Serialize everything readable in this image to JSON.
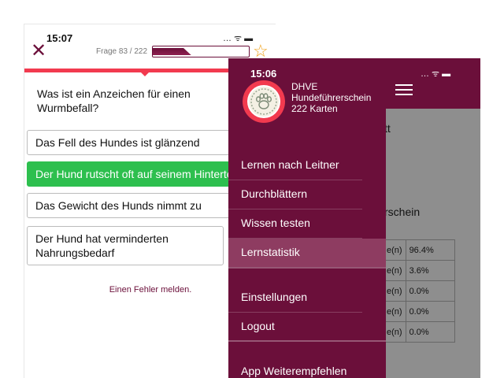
{
  "quiz": {
    "time": "15:07",
    "status_icons": "… ᯤ ▬",
    "close_icon": "✕",
    "counter": "Frage 83 / 222",
    "progress": 0.37,
    "star_icon": "☆",
    "question": "Was ist ein Anzeichen für einen Wurmbefall?",
    "answers": [
      "Das Fell des Hundes ist glänzend",
      "Der Hund rutscht oft auf seinem Hinterteil",
      "Das Gewicht des Hunds nimmt zu",
      "Der Hund hat verminderten Nahrungsbedarf"
    ],
    "report": "Einen Fehler melden."
  },
  "drawer": {
    "time": "15:06",
    "brand_line1": "DHVE",
    "brand_line2": "Hundeführerschein",
    "brand_line3": "222 Karten",
    "items": [
      "Lernen nach Leitner",
      "Durchblättern",
      "Wissen testen",
      "Lernstatistik",
      "Einstellungen",
      "Logout",
      "App Weiterempfehlen"
    ]
  },
  "stats_page": {
    "status_icons": "… ᯤ ▬",
    "frag1": "tt",
    "frag2": "rschein",
    "rows": [
      {
        "label": "e(n)",
        "value": "96.4%"
      },
      {
        "label": "e(n)",
        "value": "3.6%"
      },
      {
        "label": "e(n)",
        "value": "0.0%"
      },
      {
        "label": "e(n)",
        "value": "0.0%"
      },
      {
        "label": "e(n)",
        "value": "0.0%"
      }
    ]
  },
  "colors": {
    "brand": "#6b0f3a",
    "accent_red": "#f23a4f",
    "correct_green": "#2dbf4e",
    "star": "#f0a21a"
  }
}
